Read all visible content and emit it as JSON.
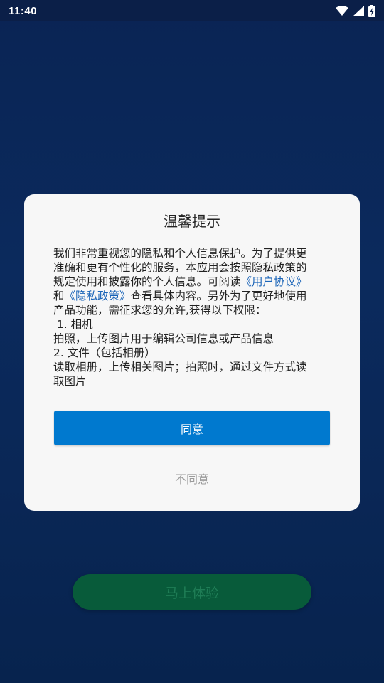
{
  "status_bar": {
    "time": "11:40"
  },
  "background": {
    "cta_label": "马上体验"
  },
  "dialog": {
    "title": "温馨提示",
    "body": {
      "line1": "我们非常重视您的隐私和个人信息保护。为了提供更",
      "line2": "准确和更有个性化的服务，本应用会按照隐私政策的",
      "line3_prefix": "规定使用和披露你的个人信息。可阅读",
      "user_agreement_link": "《用户协议》",
      "line4_prefix": "和",
      "privacy_policy_link": "《隐私政策》",
      "line4_suffix": "查看具体内容。另外为了更好地使用",
      "line5": "产品功能，需征求您的允许,获得以下权限：",
      "line6": " 1. 相机",
      "line7": "拍照，上传图片用于编辑公司信息或产品信息",
      "line8": "2. 文件（包括相册）",
      "line9": "读取相册，上传相关图片；拍照时，通过文件方式读",
      "line10": "取图片"
    },
    "agree_label": "同意",
    "disagree_label": "不同意"
  },
  "colors": {
    "background": "#0a2756",
    "dialog_bg": "#f7f7f7",
    "agree_button": "#0079cf",
    "link": "#1a64b8",
    "cta": "#085b3a"
  },
  "icons": [
    "wifi-icon",
    "cellular-signal-icon",
    "battery-charging-icon"
  ]
}
